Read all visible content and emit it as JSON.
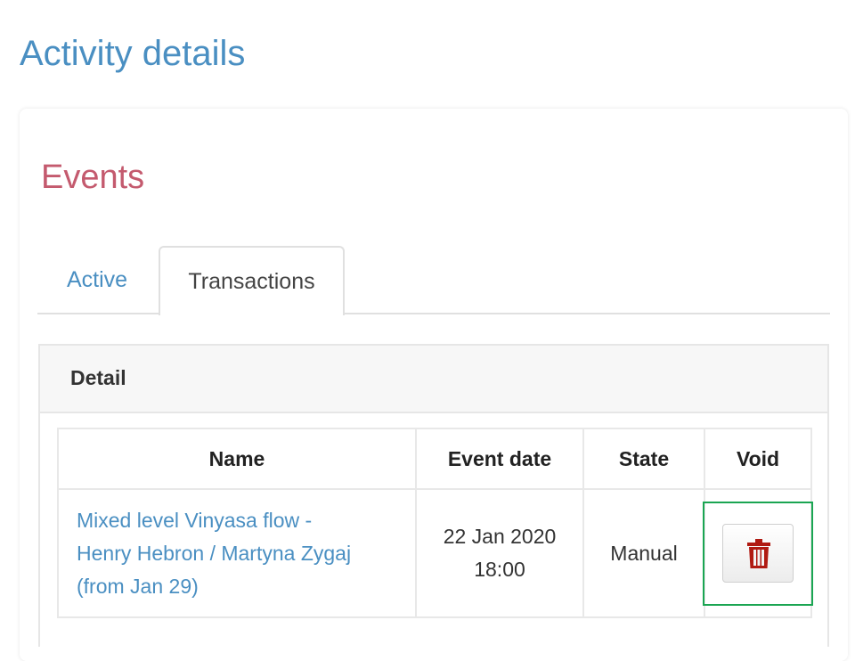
{
  "page": {
    "title": "Activity details"
  },
  "events": {
    "title": "Events",
    "tabs": [
      {
        "label": "Active",
        "selected": false
      },
      {
        "label": "Transactions",
        "selected": true
      }
    ],
    "detail": {
      "header": "Detail",
      "table": {
        "columns": [
          "Name",
          "Event date",
          "State",
          "Void"
        ],
        "rows": [
          {
            "name": "Mixed level Vinyasa flow -\nHenry Hebron / Martyna Zygaj\n(from Jan 29)",
            "event_date": "22 Jan 2020\n18:00",
            "state": "Manual",
            "void_icon": "trash-icon"
          }
        ]
      }
    }
  },
  "colors": {
    "page_title": "#4a8fc2",
    "section_title": "#c45a6e",
    "link": "#4a8fc2",
    "trash_icon": "#b01a12",
    "highlight": "#1aa552"
  }
}
